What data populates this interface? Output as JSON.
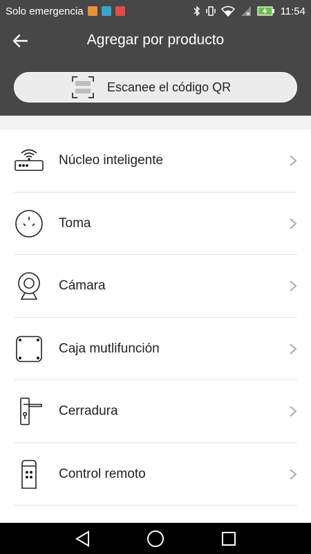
{
  "status_bar": {
    "carrier": "Solo emergencia",
    "time": "11:54",
    "notif_colors": [
      "#e8923a",
      "#3aa3c9",
      "#e24b4b"
    ]
  },
  "header": {
    "title": "Agregar por producto",
    "qr_button_label": "Escanee el código QR"
  },
  "products": [
    {
      "label": "Núcleo inteligente",
      "icon": "router-icon"
    },
    {
      "label": "Toma",
      "icon": "outlet-icon"
    },
    {
      "label": "Cámara",
      "icon": "camera-icon"
    },
    {
      "label": "Caja mutlifunción",
      "icon": "box-icon"
    },
    {
      "label": "Cerradura",
      "icon": "lock-icon"
    },
    {
      "label": "Control remoto",
      "icon": "remote-icon"
    }
  ],
  "colors": {
    "header_bg": "#474747",
    "list_bg": "#ffffff",
    "page_bg": "#f3f3f3"
  }
}
